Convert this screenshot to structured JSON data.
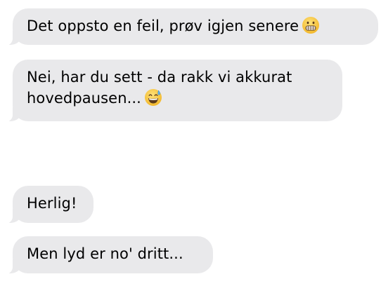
{
  "conversation": {
    "messages": [
      {
        "text": "Det oppsto en feil, prøv igjen senere",
        "emoji": "grimacing-face-icon"
      },
      {
        "text": "Nei, har du sett - da rakk vi akkurat",
        "text2": "hovedpausen...",
        "emoji": "grinning-sweat-face-icon"
      },
      {
        "text": "Herlig!"
      },
      {
        "text": "Men lyd er no' dritt..."
      }
    ]
  },
  "colors": {
    "bubble": "#e9e9eb",
    "text": "#000000",
    "emoji_face": "#f7c93e"
  }
}
